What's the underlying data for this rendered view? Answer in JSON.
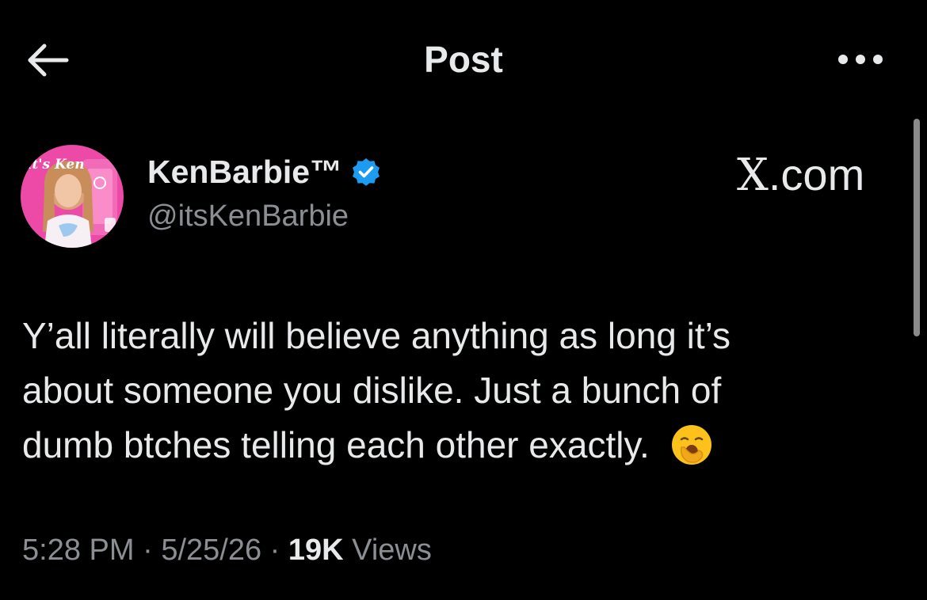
{
  "header": {
    "title": "Post",
    "back_icon": "arrow-left-icon",
    "more_icon": "more-horizontal-icon"
  },
  "author": {
    "name": "KenBarbie™",
    "handle": "@itsKenBarbie",
    "verified": true,
    "verified_color": "#1d9bf0",
    "avatar_text": "it's Ken"
  },
  "watermark": {
    "x": "X",
    "suffix": ".com"
  },
  "tweet": {
    "lines": [
      "Y’all literally will believe anything as long it’s",
      "about someone you dislike. Just a bunch of",
      "dumb btches telling each other exactly."
    ],
    "emoji": "yawning-face-emoji"
  },
  "meta": {
    "time": "5:28 PM",
    "sep1": " · ",
    "date": "5/25/26",
    "sep2": " · ",
    "views_count": "19K",
    "views_label": " Views"
  },
  "colors": {
    "background": "#000000",
    "text": "#e7e9ea",
    "secondary_text": "#8b8f94",
    "avatar_pink": "#ec4aa6"
  }
}
